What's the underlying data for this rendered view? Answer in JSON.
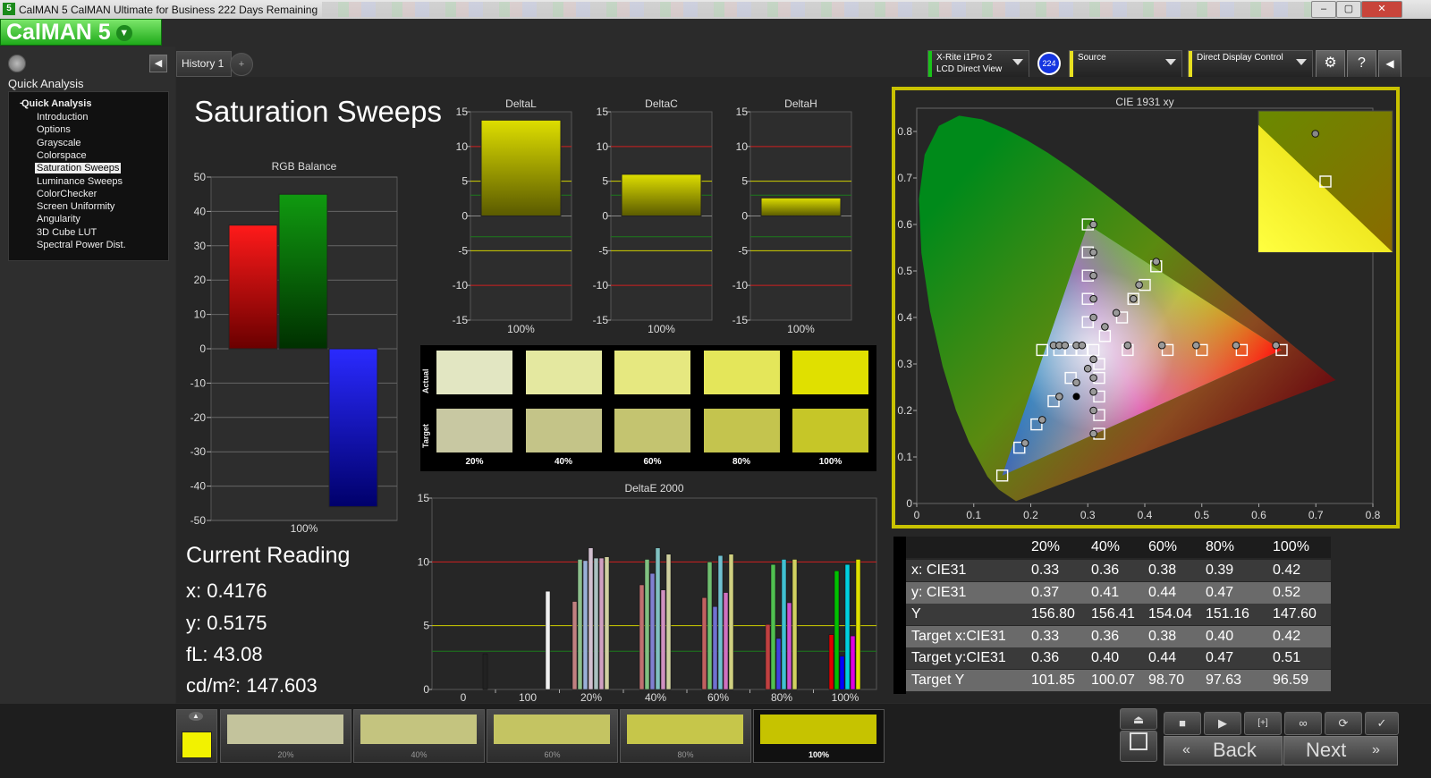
{
  "window": {
    "title": "CalMAN 5 CalMAN Ultimate for Business 222 Days Remaining",
    "icon_glyph": "5",
    "minimize": "–",
    "maximize": "▢",
    "close": "✕"
  },
  "logo": {
    "text": "CalMAN 5"
  },
  "sidebar": {
    "title": "Quick Analysis",
    "collapse_glyph": "◀",
    "tree_root": "Quick Analysis",
    "items": [
      {
        "label": "Introduction",
        "selected": false
      },
      {
        "label": "Options",
        "selected": false
      },
      {
        "label": "Grayscale",
        "selected": false
      },
      {
        "label": "Colorspace",
        "selected": false
      },
      {
        "label": "Saturation Sweeps",
        "selected": true
      },
      {
        "label": "Luminance Sweeps",
        "selected": false
      },
      {
        "label": "ColorChecker",
        "selected": false
      },
      {
        "label": "Screen Uniformity",
        "selected": false
      },
      {
        "label": "Angularity",
        "selected": false
      },
      {
        "label": "3D Cube LUT",
        "selected": false
      },
      {
        "label": "Spectral Power Dist.",
        "selected": false
      }
    ]
  },
  "tabs": {
    "history": "History 1",
    "add": "+"
  },
  "hardware": {
    "meter_line1": "X-Rite i1Pro 2",
    "meter_line2": "LCD Direct View",
    "meter_badge": "224",
    "source": "Source",
    "display": "Direct Display Control",
    "meter_color": "#19c319",
    "source_color": "#e8e020",
    "display_color": "#e8e020"
  },
  "page": {
    "title": "Saturation Sweeps"
  },
  "current_reading": {
    "title": "Current Reading",
    "x": "x: 0.4176",
    "y": "y: 0.5175",
    "fl": "fL: 43.08",
    "cdm2": "cd/m²: 147.603"
  },
  "swatches": {
    "actual_label": "Actual",
    "target_label": "Target",
    "labels": [
      "20%",
      "40%",
      "60%",
      "80%",
      "100%"
    ],
    "actual_colors": [
      "#e2e6c2",
      "#e4e8a0",
      "#e6e880",
      "#e4e65a",
      "#e0e000"
    ],
    "target_colors": [
      "#c8c8a2",
      "#c4c488",
      "#c4c470",
      "#c4c44e",
      "#c6c628"
    ]
  },
  "cie_table": {
    "headers": [
      "",
      "20%",
      "40%",
      "60%",
      "80%",
      "100%"
    ],
    "rows": [
      {
        "label": "x: CIE31",
        "values": [
          "0.33",
          "0.36",
          "0.38",
          "0.39",
          "0.42"
        ]
      },
      {
        "label": "y: CIE31",
        "values": [
          "0.37",
          "0.41",
          "0.44",
          "0.47",
          "0.52"
        ]
      },
      {
        "label": "Y",
        "values": [
          "156.80",
          "156.41",
          "154.04",
          "151.16",
          "147.60"
        ]
      },
      {
        "label": "Target x:CIE31",
        "values": [
          "0.33",
          "0.36",
          "0.38",
          "0.40",
          "0.42"
        ]
      },
      {
        "label": "Target y:CIE31",
        "values": [
          "0.36",
          "0.40",
          "0.44",
          "0.47",
          "0.51"
        ]
      },
      {
        "label": "Target Y",
        "values": [
          "101.85",
          "100.07",
          "98.70",
          "97.63",
          "96.59"
        ]
      }
    ]
  },
  "patches": {
    "items": [
      {
        "label": "20%",
        "color": "#c3c39c",
        "active": false
      },
      {
        "label": "40%",
        "color": "#c4c47f",
        "active": false
      },
      {
        "label": "60%",
        "color": "#c4c462",
        "active": false
      },
      {
        "label": "80%",
        "color": "#c6c64a",
        "active": false
      },
      {
        "label": "100%",
        "color": "#c6c300",
        "active": true
      }
    ],
    "current_color": "#f2f200"
  },
  "controls": {
    "stop": "■",
    "play": "▶",
    "frame": "[+]",
    "loop": "∞",
    "refresh": "⟳",
    "check": "✓",
    "back": "Back",
    "next": "Next"
  },
  "chart_data": [
    {
      "type": "bar",
      "title": "RGB Balance",
      "categories": [
        "100%"
      ],
      "series": [
        {
          "values": [
            36
          ],
          "color": "#ff0000"
        },
        {
          "values": [
            45
          ],
          "color": "#009000"
        },
        {
          "values": [
            -46
          ],
          "color": "#0000ff"
        }
      ],
      "ylim": [
        -50,
        50
      ],
      "yticks": [
        50,
        40,
        30,
        20,
        10,
        0,
        -10,
        -20,
        -30,
        -40,
        -50
      ]
    },
    {
      "type": "bar",
      "title": "DeltaL",
      "categories": [
        "100%"
      ],
      "values": [
        13.8
      ],
      "ylim": [
        -15,
        15
      ],
      "yticks": [
        15,
        10,
        5,
        0,
        -5,
        -10,
        -15
      ]
    },
    {
      "type": "bar",
      "title": "DeltaC",
      "categories": [
        "100%"
      ],
      "values": [
        6
      ],
      "ylim": [
        -15,
        15
      ],
      "yticks": [
        15,
        10,
        5,
        0,
        -5,
        -10,
        -15
      ]
    },
    {
      "type": "bar",
      "title": "DeltaH",
      "categories": [
        "100%"
      ],
      "values": [
        2.6
      ],
      "ylim": [
        -15,
        15
      ],
      "yticks": [
        15,
        10,
        5,
        0,
        -5,
        -10,
        -15
      ]
    },
    {
      "type": "bar",
      "title": "DeltaE 2000",
      "categories": [
        "0",
        "100",
        "20%",
        "40%",
        "60%",
        "80%",
        "100%"
      ],
      "ylim": [
        0,
        15
      ],
      "yticks": [
        15,
        10,
        5,
        0
      ],
      "groups": [
        {
          "category": "0",
          "bars": [
            {
              "v": 2.8,
              "c": "#222222"
            }
          ]
        },
        {
          "category": "100",
          "bars": [
            {
              "v": 7.7,
              "c": "#f0f0f0"
            }
          ]
        },
        {
          "category": "20%",
          "bars": [
            {
              "v": 6.9,
              "c": "#c08080"
            },
            {
              "v": 10.2,
              "c": "#8cbf8c"
            },
            {
              "v": 10.1,
              "c": "#9ab0d8"
            },
            {
              "v": 11.1,
              "c": "#d2c0d0"
            },
            {
              "v": 10.3,
              "c": "#aac0c0"
            },
            {
              "v": 10.3,
              "c": "#d0a0c0"
            },
            {
              "v": 10.4,
              "c": "#d0d0a0"
            }
          ]
        },
        {
          "category": "40%",
          "bars": [
            {
              "v": 8.2,
              "c": "#c07070"
            },
            {
              "v": 10.2,
              "c": "#80c080"
            },
            {
              "v": 9.1,
              "c": "#8080d0"
            },
            {
              "v": 11.1,
              "c": "#80c0c0"
            },
            {
              "v": 7.8,
              "c": "#d090c0"
            },
            {
              "v": 10.6,
              "c": "#d0d0a0"
            }
          ]
        },
        {
          "category": "60%",
          "bars": [
            {
              "v": 7.2,
              "c": "#c06060"
            },
            {
              "v": 10.0,
              "c": "#70c070"
            },
            {
              "v": 6.5,
              "c": "#7070d0"
            },
            {
              "v": 10.5,
              "c": "#70c0d0"
            },
            {
              "v": 7.6,
              "c": "#d070c0"
            },
            {
              "v": 10.6,
              "c": "#d0d080"
            }
          ]
        },
        {
          "category": "80%",
          "bars": [
            {
              "v": 5.1,
              "c": "#c04040"
            },
            {
              "v": 9.8,
              "c": "#50c050"
            },
            {
              "v": 4.0,
              "c": "#4040e0"
            },
            {
              "v": 10.2,
              "c": "#40c0d0"
            },
            {
              "v": 6.8,
              "c": "#d050d0"
            },
            {
              "v": 10.2,
              "c": "#d0d060"
            }
          ]
        },
        {
          "category": "100%",
          "bars": [
            {
              "v": 4.3,
              "c": "#e00000"
            },
            {
              "v": 9.3,
              "c": "#00c000"
            },
            {
              "v": 2.6,
              "c": "#0000ff"
            },
            {
              "v": 9.8,
              "c": "#00d0e0"
            },
            {
              "v": 4.2,
              "c": "#e000e0"
            },
            {
              "v": 10.2,
              "c": "#e0e000"
            }
          ]
        }
      ],
      "reference_lines": [
        10,
        5,
        3
      ]
    },
    {
      "type": "scatter",
      "title": "CIE 1931 xy",
      "xlim": [
        0,
        0.8
      ],
      "ylim": [
        0,
        0.85
      ],
      "xticks": [
        0,
        0.1,
        0.2,
        0.3,
        0.4,
        0.5,
        0.6,
        0.7,
        0.8
      ],
      "yticks": [
        0,
        0.1,
        0.2,
        0.3,
        0.4,
        0.5,
        0.6,
        0.7,
        0.8
      ],
      "gamut_triangle": [
        [
          0.64,
          0.33
        ],
        [
          0.3,
          0.6
        ],
        [
          0.15,
          0.06
        ]
      ],
      "white_point": [
        0.3127,
        0.329
      ],
      "targets": [
        [
          0.3,
          0.6
        ],
        [
          0.3,
          0.54
        ],
        [
          0.3,
          0.49
        ],
        [
          0.3,
          0.44
        ],
        [
          0.3,
          0.39
        ],
        [
          0.42,
          0.51
        ],
        [
          0.4,
          0.47
        ],
        [
          0.38,
          0.44
        ],
        [
          0.36,
          0.4
        ],
        [
          0.33,
          0.36
        ],
        [
          0.64,
          0.33
        ],
        [
          0.57,
          0.33
        ],
        [
          0.5,
          0.33
        ],
        [
          0.44,
          0.33
        ],
        [
          0.37,
          0.33
        ],
        [
          0.15,
          0.06
        ],
        [
          0.18,
          0.12
        ],
        [
          0.21,
          0.17
        ],
        [
          0.24,
          0.22
        ],
        [
          0.27,
          0.27
        ],
        [
          0.22,
          0.33
        ],
        [
          0.25,
          0.33
        ],
        [
          0.27,
          0.33
        ],
        [
          0.29,
          0.33
        ],
        [
          0.31,
          0.33
        ],
        [
          0.32,
          0.15
        ],
        [
          0.32,
          0.19
        ],
        [
          0.32,
          0.23
        ],
        [
          0.32,
          0.27
        ],
        [
          0.32,
          0.3
        ]
      ],
      "measured": [
        [
          0.31,
          0.6
        ],
        [
          0.31,
          0.54
        ],
        [
          0.31,
          0.49
        ],
        [
          0.31,
          0.44
        ],
        [
          0.31,
          0.4
        ],
        [
          0.42,
          0.52
        ],
        [
          0.39,
          0.47
        ],
        [
          0.38,
          0.44
        ],
        [
          0.35,
          0.41
        ],
        [
          0.33,
          0.38
        ],
        [
          0.63,
          0.34
        ],
        [
          0.56,
          0.34
        ],
        [
          0.49,
          0.34
        ],
        [
          0.43,
          0.34
        ],
        [
          0.37,
          0.34
        ],
        [
          0.19,
          0.13
        ],
        [
          0.22,
          0.18
        ],
        [
          0.25,
          0.23
        ],
        [
          0.28,
          0.26
        ],
        [
          0.3,
          0.29
        ],
        [
          0.24,
          0.34
        ],
        [
          0.25,
          0.34
        ],
        [
          0.26,
          0.34
        ],
        [
          0.28,
          0.34
        ],
        [
          0.29,
          0.34
        ],
        [
          0.31,
          0.15
        ],
        [
          0.31,
          0.2
        ],
        [
          0.31,
          0.24
        ],
        [
          0.31,
          0.27
        ],
        [
          0.31,
          0.31
        ]
      ],
      "black_point": [
        0.28,
        0.23
      ],
      "inset": {
        "target": [
          0.42,
          0.51
        ],
        "measured": [
          0.4176,
          0.5175
        ]
      }
    }
  ]
}
